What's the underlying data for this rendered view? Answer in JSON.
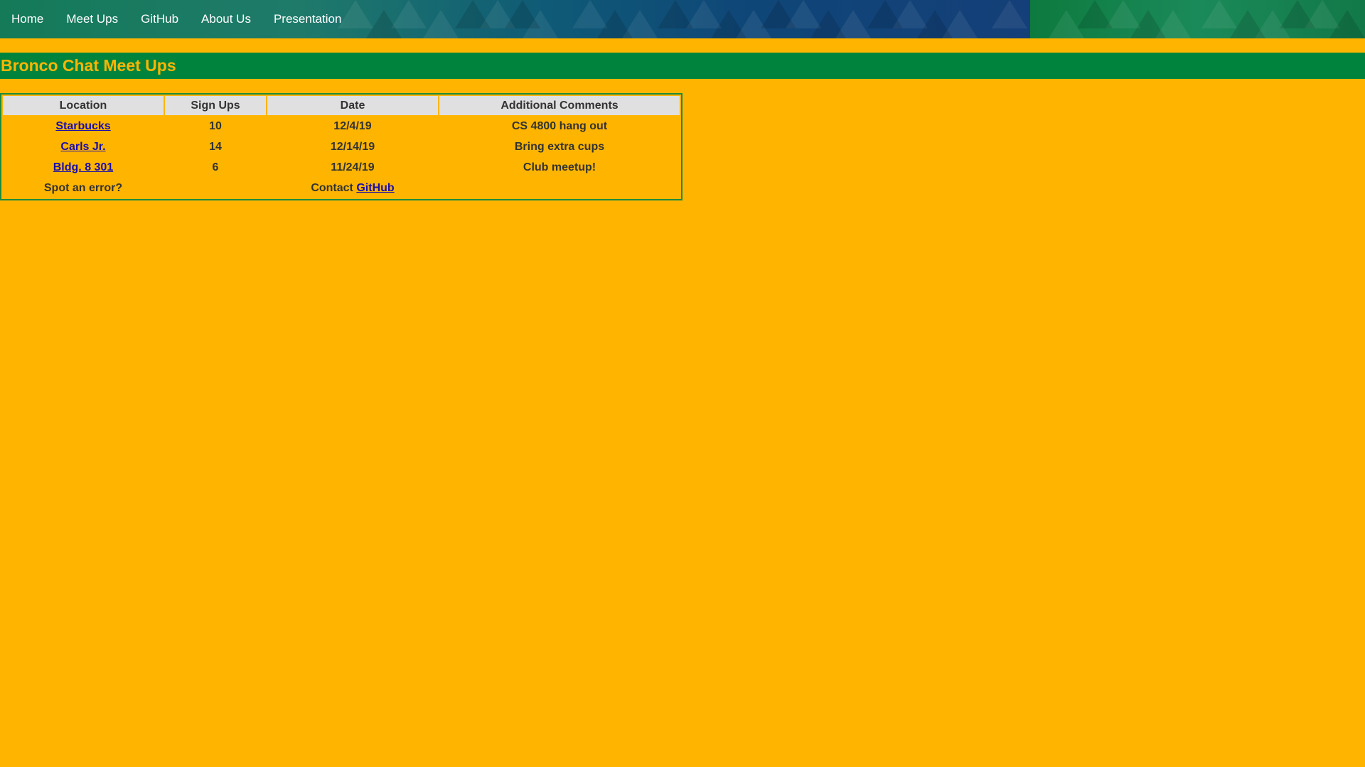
{
  "nav": {
    "items": [
      {
        "label": "Home"
      },
      {
        "label": "Meet Ups"
      },
      {
        "label": "GitHub"
      },
      {
        "label": "About Us"
      },
      {
        "label": "Presentation"
      }
    ]
  },
  "page": {
    "title": "Bronco Chat Meet Ups"
  },
  "table": {
    "headers": [
      "Location",
      "Sign Ups",
      "Date",
      "Additional Comments"
    ],
    "rows": [
      {
        "location": "Starbucks",
        "signups": "10",
        "date": "12/4/19",
        "comments": "CS 4800 hang out"
      },
      {
        "location": "Carls Jr.",
        "signups": "14",
        "date": "12/14/19",
        "comments": "Bring extra cups"
      },
      {
        "location": "Bldg. 8 301",
        "signups": "6",
        "date": "11/24/19",
        "comments": "Club meetup!"
      }
    ],
    "footer": {
      "error_text": "Spot an error?",
      "contact_text": "Contact",
      "contact_link": "GitHub"
    }
  },
  "colors": {
    "background": "#FFB500",
    "title_bar": "#00843D",
    "title_text": "#FFB500",
    "link": "#1a0dab",
    "header_cell": "#e0e0e0"
  }
}
